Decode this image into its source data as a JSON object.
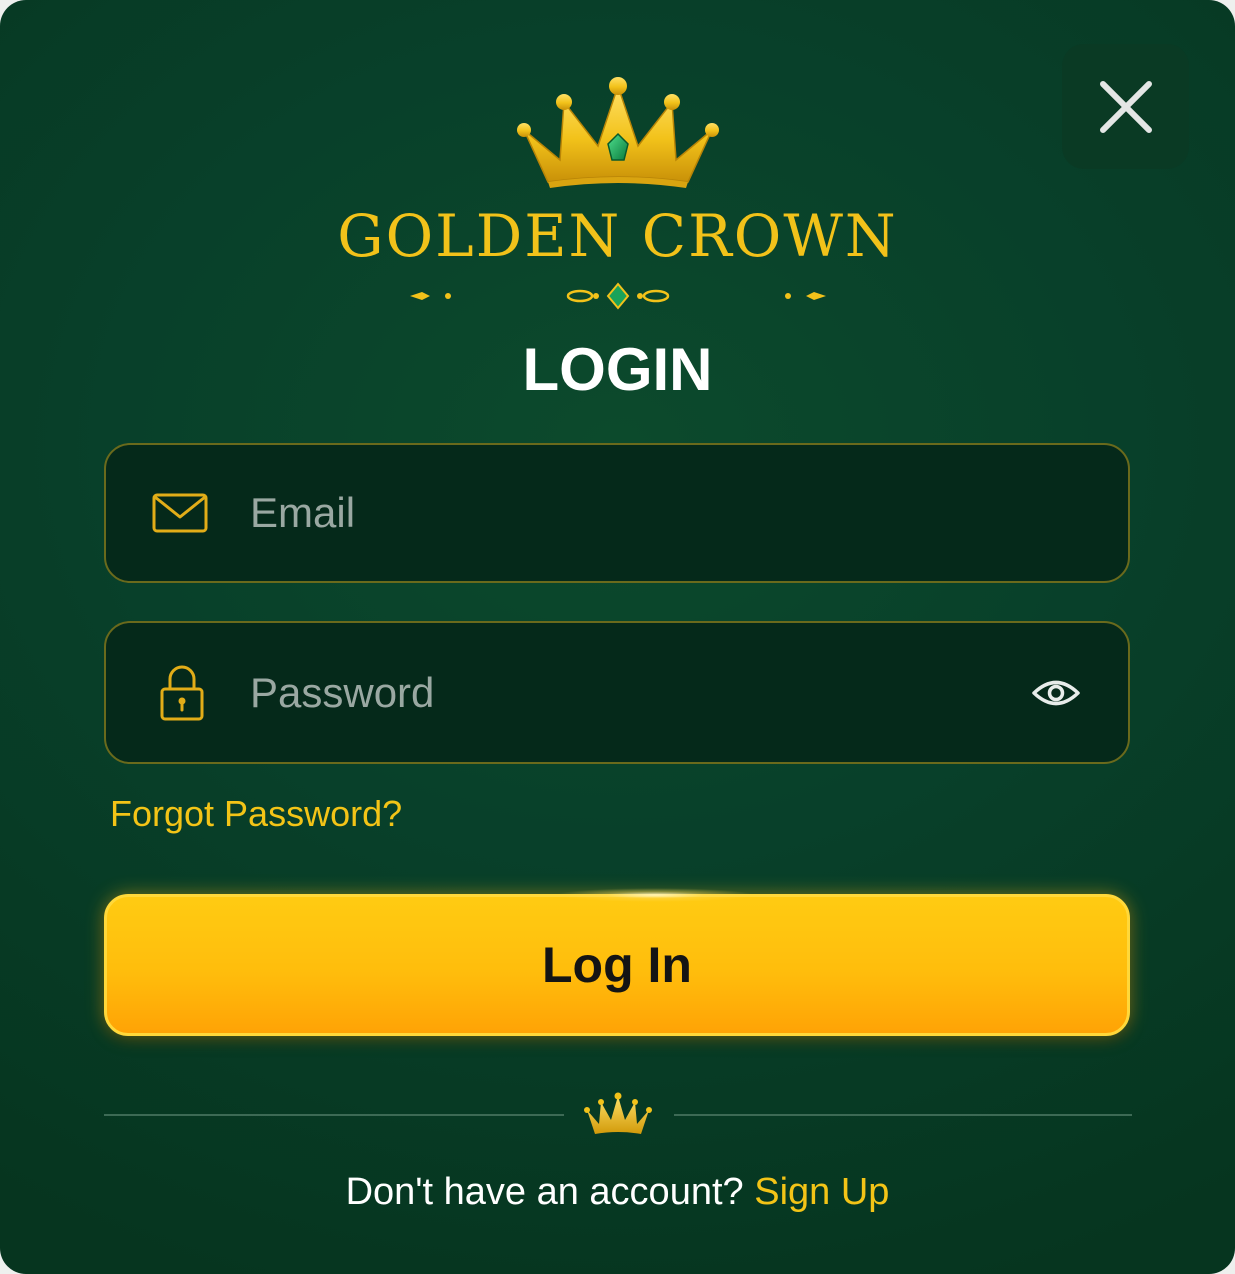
{
  "brand": {
    "name": "GOLDEN CROWN"
  },
  "title": "LOGIN",
  "email_field": {
    "placeholder": "Email",
    "value": ""
  },
  "password_field": {
    "placeholder": "Password",
    "value": ""
  },
  "forgot_password_label": "Forgot Password?",
  "login_button_label": "Log In",
  "signup": {
    "prompt": "Don't have an account?",
    "link_label": "Sign Up"
  },
  "icons": {
    "close": "close-icon",
    "logo": "crown-icon",
    "email": "envelope-icon",
    "password": "lock-icon",
    "visibility": "eye-icon",
    "divider": "crown-icon"
  },
  "colors": {
    "background": "#08402a",
    "gold": "#f2c21a",
    "button": "#ffbd0c",
    "field_background": "#05291a",
    "field_border": "#6a6a1c",
    "emerald": "#1aa35a"
  }
}
